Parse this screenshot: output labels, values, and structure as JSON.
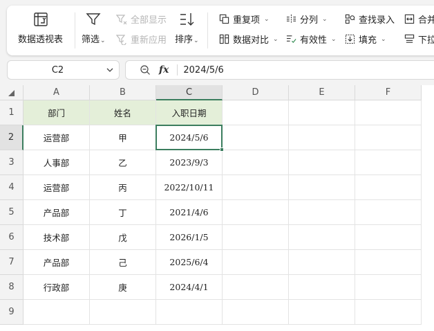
{
  "ribbon": {
    "pivot_label": "数据透视表",
    "filter_label": "筛选",
    "show_all_label": "全部显示",
    "reapply_label": "重新应用",
    "sort_label": "排序",
    "duplicates_label": "重复项",
    "compare_label": "数据对比",
    "split_label": "分列",
    "validation_label": "有效性",
    "lookup_label": "查找录入",
    "fill_label": "填充",
    "merge_label": "合并",
    "dropdown_label": "下拉"
  },
  "formula_bar": {
    "name_box": "C2",
    "fx": "fx",
    "value": "2024/5/6"
  },
  "sheet": {
    "columns": [
      "A",
      "B",
      "C",
      "D",
      "E",
      "F"
    ],
    "rows": [
      "1",
      "2",
      "3",
      "4",
      "5",
      "6",
      "7",
      "8",
      "9"
    ],
    "headers": [
      "部门",
      "姓名",
      "入职日期"
    ],
    "data": [
      [
        "运营部",
        "甲",
        "2024/5/6"
      ],
      [
        "人事部",
        "乙",
        "2023/9/3"
      ],
      [
        "运营部",
        "丙",
        "2022/10/11"
      ],
      [
        "产品部",
        "丁",
        "2021/4/6"
      ],
      [
        "技术部",
        "戊",
        "2026/1/5"
      ],
      [
        "产品部",
        "己",
        "2025/6/4"
      ],
      [
        "行政部",
        "庚",
        "2024/4/1"
      ]
    ],
    "active_cell": "C2"
  },
  "colors": {
    "accent": "#3b7d5e",
    "header_fill": "#e4efd9"
  }
}
